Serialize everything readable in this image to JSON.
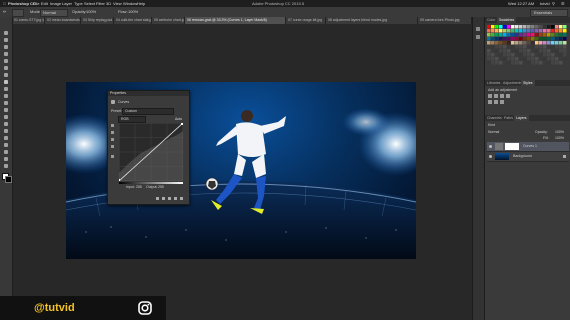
{
  "menubar": {
    "items": [
      "Photoshop CC",
      "File",
      "Edit",
      "Image",
      "Layer",
      "Type",
      "Select",
      "Filter",
      "3D",
      "View",
      "Window",
      "Help"
    ],
    "title": "Adobe Photoshop CC 2015.5",
    "clock": "Wed 12:27 AM",
    "user": "tutvid"
  },
  "options": {
    "mode_label": "Mode:",
    "mode_value": "Normal",
    "opacity_label": "Opacity:",
    "opacity_value": "100%",
    "flow_label": "Flow:",
    "flow_value": "100%",
    "workspace": "Essentials"
  },
  "tabs": [
    {
      "label": "01 comic-STY.jpg @ 16..."
    },
    {
      "label": "02 mean-boardwinds.jpg..."
    },
    {
      "label": "03 Ship replag.psd @..."
    },
    {
      "label": "04 culit-the chart stat.jpg"
    },
    {
      "label": "05 weitrohn chart.jpg"
    },
    {
      "label": "06 remoan-graf-@ 33.3% (Curves 1, Layer Mask/8)",
      "active": true
    },
    {
      "label": "07 curse-range-bit.jpg"
    },
    {
      "label": "08 adjustment layers blend modes.jpg"
    },
    {
      "label": "09 camera fore-Photo.jpg"
    }
  ],
  "properties": {
    "tab": "Properties",
    "title": "Curves",
    "preset_label": "Preset:",
    "preset_value": "Custom",
    "channel_value": "RGB",
    "auto_label": "Auto",
    "input_label": "Input:",
    "input_value": "255",
    "output_label": "Output:",
    "output_value": "255"
  },
  "panels": {
    "top_tabs": [
      "Color",
      "Swatches"
    ],
    "mid_tabs": [
      "Libraries",
      "Adjustments",
      "Styles"
    ],
    "mid_label": "Add an adjustment",
    "bottom_tabs": [
      "Channels",
      "Paths",
      "Layers"
    ],
    "kind_label": "Kind",
    "blend_value": "Normal",
    "opacity_label": "Opacity:",
    "opacity_value": "100%",
    "fill_label": "Fill:",
    "fill_value": "100%",
    "layers": [
      {
        "name": "Curves 1",
        "selected": true
      },
      {
        "name": "Background",
        "selected": false
      }
    ]
  },
  "watermark": {
    "handle": "@tutvid",
    "icon": "instagram-icon",
    "color": "#f6c423"
  }
}
